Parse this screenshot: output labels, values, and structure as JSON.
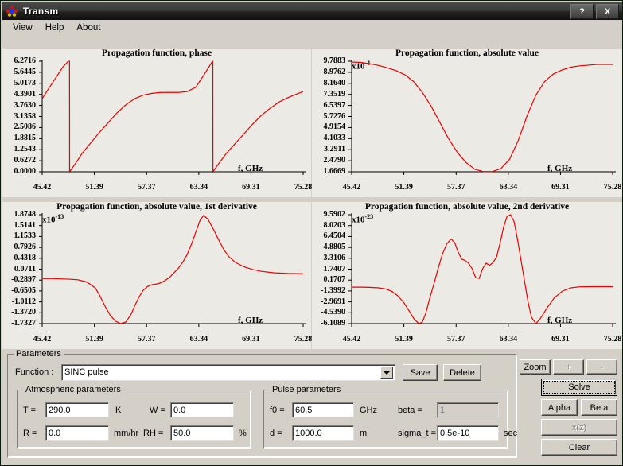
{
  "window": {
    "title": "Transm",
    "icon": "app-flower-icon",
    "buttons": [
      {
        "name": "help-button",
        "label": "?"
      },
      {
        "name": "close-button",
        "label": "X"
      }
    ]
  },
  "menu": {
    "items": [
      {
        "name": "menu-view",
        "label": "View"
      },
      {
        "name": "menu-help",
        "label": "Help"
      },
      {
        "name": "menu-about",
        "label": "About"
      }
    ]
  },
  "colors": {
    "curve": "#ee0000",
    "axis": "#000000",
    "chart_bg": "#eceae4",
    "window_bg": "#d4d0c8"
  },
  "chart_data": [
    {
      "type": "line",
      "title": "Propagation function, phase",
      "xlabel": "f, GHz",
      "ylabel": "",
      "scale_note": "",
      "scale_exp": "",
      "xticks": [
        "45.42",
        "51.39",
        "57.37",
        "63.34",
        "69.31",
        "75.28"
      ],
      "yticks": [
        "6.2716",
        "5.6445",
        "5.0173",
        "4.3901",
        "3.7630",
        "3.1358",
        "2.5086",
        "1.8815",
        "1.2543",
        "0.6272",
        "0.0000"
      ],
      "xlim": [
        45.42,
        75.28
      ],
      "ylim": [
        0.0,
        6.2716
      ],
      "x": [
        45.42,
        46.2,
        47.0,
        47.8,
        48.4,
        48.55,
        48.56,
        49.2,
        50.0,
        51.0,
        52.0,
        53.0,
        54.0,
        55.0,
        56.0,
        57.0,
        58.0,
        59.0,
        60.0,
        61.0,
        62.0,
        63.0,
        64.0,
        64.9,
        64.95,
        64.96,
        65.6,
        66.5,
        67.5,
        68.5,
        69.5,
        70.5,
        71.5,
        72.5,
        73.5,
        74.5,
        75.28
      ],
      "y": [
        4.15,
        4.75,
        5.35,
        5.95,
        6.27,
        6.27,
        0.0,
        0.45,
        1.05,
        1.65,
        2.25,
        2.8,
        3.35,
        3.8,
        4.15,
        4.35,
        4.45,
        4.5,
        4.5,
        4.5,
        4.55,
        4.8,
        5.55,
        6.27,
        6.27,
        0.0,
        0.45,
        1.05,
        1.6,
        2.15,
        2.7,
        3.2,
        3.6,
        3.95,
        4.2,
        4.4,
        4.55
      ]
    },
    {
      "type": "line",
      "title": "Propagation function, absolute value",
      "xlabel": "f, GHz",
      "ylabel": "",
      "scale_note": "x10",
      "scale_exp": "-4",
      "xticks": [
        "45.42",
        "51.39",
        "57.37",
        "63.34",
        "69.31",
        "75.28"
      ],
      "yticks": [
        "9.7883",
        "8.9762",
        "8.1640",
        "7.3519",
        "6.5397",
        "5.7276",
        "4.9154",
        "4.1033",
        "3.2911",
        "2.4790",
        "1.6669"
      ],
      "xlim": [
        45.42,
        75.28
      ],
      "ylim": [
        1.6669,
        9.7883
      ],
      "x": [
        45.42,
        46.5,
        47.5,
        48.5,
        49.5,
        50.5,
        51.5,
        52.5,
        53.5,
        54.5,
        55.5,
        56.5,
        57.5,
        58.5,
        59.5,
        60.5,
        61.5,
        62.5,
        63.5,
        64.5,
        65.5,
        66.5,
        67.5,
        68.5,
        69.5,
        70.5,
        71.5,
        72.5,
        73.5,
        74.5,
        75.28
      ],
      "y": [
        9.73,
        9.7,
        9.6,
        9.48,
        9.3,
        9.1,
        8.8,
        8.3,
        7.5,
        6.5,
        5.3,
        4.1,
        3.1,
        2.35,
        1.85,
        1.68,
        1.68,
        1.9,
        2.6,
        4.0,
        5.8,
        7.3,
        8.3,
        8.85,
        9.15,
        9.35,
        9.45,
        9.5,
        9.55,
        9.55,
        9.55
      ]
    },
    {
      "type": "line",
      "title": "Propagation function, absolute value, 1st derivative",
      "xlabel": "f, GHz",
      "ylabel": "",
      "scale_note": "x10",
      "scale_exp": "-13",
      "xticks": [
        "45.42",
        "51.39",
        "57.37",
        "63.34",
        "69.31",
        "75.28"
      ],
      "yticks": [
        "1.8748",
        "1.5141",
        "1.1533",
        "0.7926",
        "0.4318",
        "0.0711",
        "-0.2897",
        "-0.6505",
        "-1.0112",
        "-1.3720",
        "-1.7327"
      ],
      "xlim": [
        45.42,
        75.28
      ],
      "ylim": [
        -1.7327,
        1.8748
      ],
      "x": [
        45.42,
        46.5,
        47.5,
        48.5,
        49.5,
        50.5,
        51.5,
        52.0,
        52.6,
        53.2,
        53.8,
        54.4,
        55.0,
        55.6,
        56.0,
        56.5,
        57.0,
        57.5,
        58.0,
        58.5,
        59.0,
        59.5,
        60.0,
        60.5,
        61.0,
        61.5,
        62.0,
        62.5,
        63.0,
        63.5,
        63.9,
        64.4,
        65.0,
        65.6,
        66.2,
        66.8,
        67.5,
        68.5,
        69.5,
        70.5,
        72.0,
        73.5,
        75.28
      ],
      "y": [
        -0.24,
        -0.24,
        -0.25,
        -0.26,
        -0.28,
        -0.35,
        -0.55,
        -0.8,
        -1.15,
        -1.45,
        -1.65,
        -1.73,
        -1.68,
        -1.42,
        -1.15,
        -0.85,
        -0.62,
        -0.5,
        -0.44,
        -0.42,
        -0.38,
        -0.3,
        -0.2,
        -0.05,
        0.1,
        0.3,
        0.55,
        0.9,
        1.3,
        1.7,
        1.85,
        1.72,
        1.4,
        1.05,
        0.72,
        0.48,
        0.3,
        0.15,
        0.06,
        0.0,
        -0.05,
        -0.07,
        -0.08
      ]
    },
    {
      "type": "line",
      "title": "Propagation function, absolute value, 2nd derivative",
      "xlabel": "f, GHz",
      "ylabel": "",
      "scale_note": "x10",
      "scale_exp": "-23",
      "xticks": [
        "45.42",
        "51.39",
        "57.37",
        "63.34",
        "69.31",
        "75.28"
      ],
      "yticks": [
        "9.5902",
        "8.0203",
        "6.4504",
        "4.8805",
        "3.3106",
        "1.7407",
        "0.1707",
        "-1.3992",
        "-2.9691",
        "-4.5390",
        "-6.1089"
      ],
      "xlim": [
        45.42,
        75.28
      ],
      "ylim": [
        -6.1089,
        9.5902
      ],
      "x": [
        45.42,
        46.5,
        47.5,
        48.5,
        49.3,
        50.0,
        50.7,
        51.4,
        52.0,
        52.6,
        53.1,
        53.5,
        53.9,
        54.3,
        54.8,
        55.3,
        55.8,
        56.3,
        56.8,
        57.2,
        57.6,
        58.0,
        58.4,
        58.8,
        59.2,
        59.6,
        60.0,
        60.4,
        60.8,
        61.2,
        61.6,
        62.0,
        62.4,
        62.8,
        63.2,
        63.6,
        64.0,
        64.4,
        64.8,
        65.2,
        65.6,
        66.0,
        66.5,
        67.0,
        67.8,
        68.6,
        69.5,
        70.5,
        71.5,
        73.0,
        75.28
      ],
      "y": [
        -0.85,
        -0.85,
        -0.88,
        -0.95,
        -1.1,
        -1.45,
        -2.1,
        -3.1,
        -4.3,
        -5.5,
        -6.1,
        -5.9,
        -4.6,
        -2.7,
        -0.5,
        1.8,
        3.9,
        5.4,
        6.1,
        5.6,
        4.2,
        3.2,
        3.0,
        2.6,
        1.8,
        0.55,
        0.4,
        1.8,
        2.6,
        2.3,
        2.7,
        3.5,
        5.5,
        7.8,
        9.35,
        9.59,
        8.6,
        6.0,
        3.0,
        0.0,
        -3.0,
        -5.2,
        -6.1,
        -5.4,
        -3.8,
        -2.4,
        -1.45,
        -0.95,
        -0.8,
        -0.78,
        -0.78
      ]
    }
  ],
  "parameters": {
    "group_title": "Parameters",
    "function_label": "Function :",
    "function_value": "SINC pulse",
    "save_label": "Save",
    "delete_label": "Delete",
    "atmospheric": {
      "group_title": "Atmospheric parameters",
      "t_label": "T =",
      "t_value": "290.0",
      "t_unit": "K",
      "r_label": "R =",
      "r_value": "0.0",
      "r_unit": "mm/hr",
      "w_label": "W =",
      "w_value": "0.0",
      "rh_label": "RH =",
      "rh_value": "50.0",
      "rh_unit": "%"
    },
    "pulse": {
      "group_title": "Pulse parameters",
      "f0_label": "f0 =",
      "f0_value": "60.5",
      "f0_unit": "GHz",
      "d_label": "d =",
      "d_value": "1000.0",
      "d_unit": "m",
      "beta_label": "beta =",
      "beta_value": "1",
      "sigma_label": "sigma_t =",
      "sigma_value": "0.5e-10",
      "sigma_unit": "sec"
    }
  },
  "actions": {
    "zoom_label": "Zoom",
    "plus_label": "+",
    "minus_label": "-",
    "solve_label": "Solve",
    "alpha_label": "Alpha",
    "beta_label": "Beta",
    "xz_label": "x(z)",
    "clear_label": "Clear"
  }
}
